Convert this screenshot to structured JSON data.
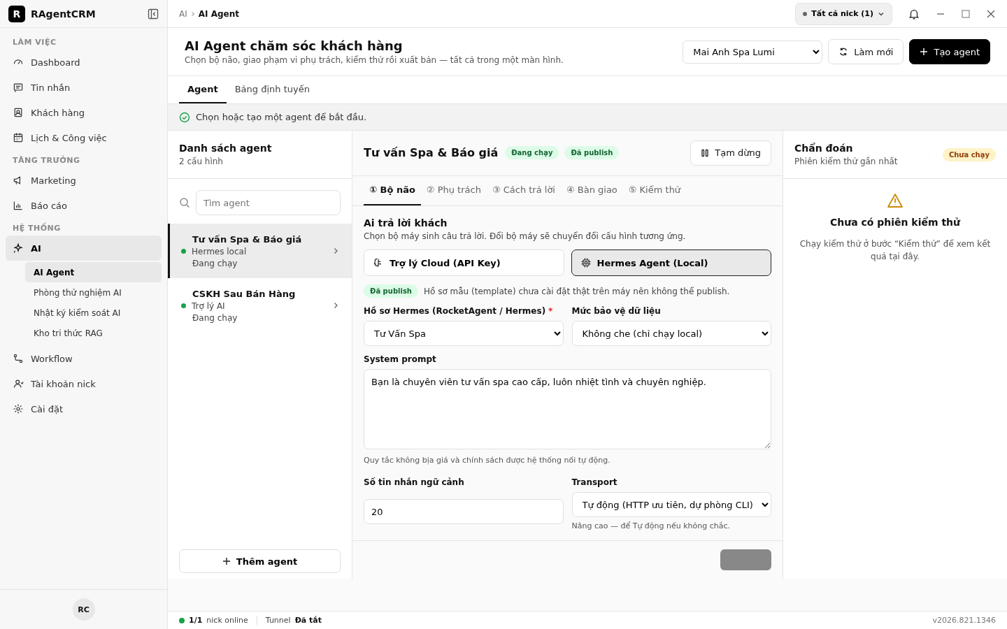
{
  "app": {
    "logo_letter": "R",
    "name": "RAgentCRM"
  },
  "sidebar": {
    "sections": [
      {
        "title": "LÀM VIỆC",
        "items": [
          {
            "label": "Dashboard",
            "selected": false
          },
          {
            "label": "Tin nhắn",
            "selected": false
          },
          {
            "label": "Khách hàng",
            "selected": false
          },
          {
            "label": "Lịch & Công việc",
            "selected": false
          }
        ]
      },
      {
        "title": "TĂNG TRƯỞNG",
        "items": [
          {
            "label": "Marketing",
            "selected": false
          },
          {
            "label": "Báo cáo",
            "selected": false
          }
        ]
      },
      {
        "title": "HỆ THỐNG",
        "items": [
          {
            "label": "AI",
            "selected": true,
            "children": [
              {
                "label": "AI Agent",
                "selected": true
              },
              {
                "label": "Phòng thử nghiệm AI",
                "selected": false
              },
              {
                "label": "Nhật ký kiểm soát AI",
                "selected": false
              },
              {
                "label": "Kho tri thức RAG",
                "selected": false
              }
            ]
          },
          {
            "label": "Workflow",
            "selected": false
          },
          {
            "label": "Tài khoản nick",
            "selected": false
          },
          {
            "label": "Cài đặt",
            "selected": false
          }
        ]
      }
    ],
    "user_initials": "RC"
  },
  "breadcrumb": [
    "AI",
    "AI Agent"
  ],
  "account_filter": "Tất cả nick (1)",
  "header": {
    "title": "AI Agent chăm sóc khách hàng",
    "subtitle": "Chọn bộ não, giao phạm vi phụ trách, kiểm thử rồi xuất bản — tất cả trong một màn hình.",
    "workspace": "Mai Anh Spa Lumi",
    "refresh": "Làm mới",
    "create": "Tạo agent"
  },
  "tabs": [
    {
      "label": "Agent",
      "selected": true
    },
    {
      "label": "Bảng định tuyến",
      "selected": false
    }
  ],
  "notice": "Chọn hoặc tạo một agent để bắt đầu.",
  "agent_list": {
    "title": "Danh sách agent",
    "count": "2 cấu hình",
    "search_placeholder": "Tìm agent",
    "add": "Thêm agent",
    "agents": [
      {
        "name": "Tư vấn Spa & Báo giá",
        "engine": "Hermes local",
        "status": "Đang chạy",
        "color": "#16a34a",
        "selected": true
      },
      {
        "name": "CSKH Sau Bán Hàng",
        "engine": "Trợ lý AI",
        "status": "Đang chạy",
        "color": "#16a34a",
        "selected": false
      }
    ]
  },
  "editor": {
    "title": "Tư vấn Spa & Báo giá",
    "badges": [
      "Đang chạy",
      "Đã publish"
    ],
    "pause": "Tạm dừng",
    "steps": [
      {
        "label": "① Bộ não",
        "selected": true
      },
      {
        "label": "② Phụ trách",
        "selected": false
      },
      {
        "label": "③ Cách trả lời",
        "selected": false
      },
      {
        "label": "④ Bàn giao",
        "selected": false
      },
      {
        "label": "⑤ Kiểm thử",
        "selected": false
      }
    ],
    "section_title": "Ai trả lời khách",
    "section_desc": "Chọn bộ máy sinh câu trả lời. Đổi bộ máy sẽ chuyển đổi cấu hình tương ứng.",
    "engines": [
      {
        "label": "Trợ lý Cloud (API Key)",
        "selected": false
      },
      {
        "label": "Hermes Agent (Local)",
        "selected": true
      }
    ],
    "publish_badge": "Đã publish",
    "publish_note": "Hồ sơ mẫu (template) chưa cài đặt thật trên máy nên không thể publish.",
    "profile_label": "Hồ sơ Hermes (RocketAgent / Hermes)",
    "profile_required_mark": "*",
    "profile_value": "Tư Vấn Spa",
    "protection_label": "Mức bảo vệ dữ liệu",
    "protection_value": "Không che (chỉ chạy local)",
    "prompt_label": "System prompt",
    "prompt_value": "Bạn là chuyên viên tư vấn spa cao cấp, luôn nhiệt tình và chuyên nghiệp.",
    "prompt_hint": "Quy tắc không bịa giá và chính sách được hệ thống nối tự động.",
    "context_label": "Số tin nhắn ngữ cảnh",
    "context_value": "20",
    "transport_label": "Transport",
    "transport_value": "Tự động (HTTP ưu tiên, dự phòng CLI)",
    "transport_hint": "Nâng cao — để Tự động nếu không chắc."
  },
  "diagnostics": {
    "title": "Chẩn đoán",
    "subtitle": "Phiên kiểm thử gần nhất",
    "badge": "Chưa chạy",
    "empty_title": "Chưa có phiên kiểm thử",
    "empty_text": "Chạy kiểm thử ở bước “Kiểm thử” để xem kết quả tại đây."
  },
  "status_bar": {
    "online_count": "1/1",
    "online_label": "nick online",
    "tunnel_label": "Tunnel",
    "tunnel_value": "Đã tắt",
    "version": "v2026.821.1346"
  }
}
